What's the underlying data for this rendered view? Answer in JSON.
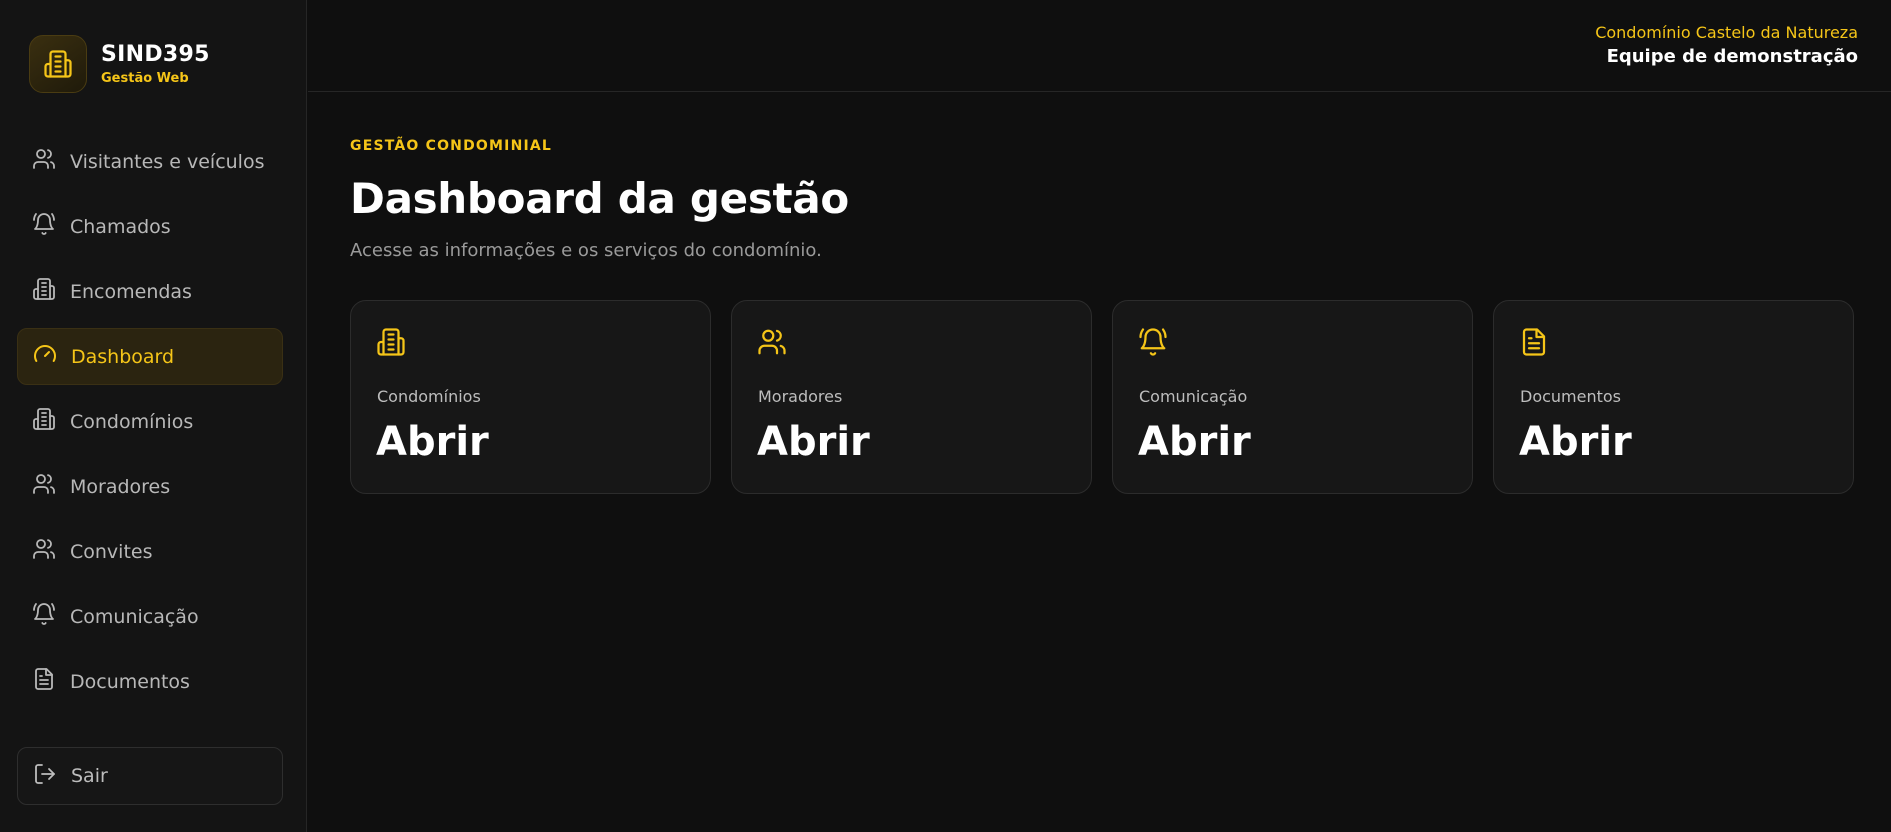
{
  "brand": {
    "name": "SIND395",
    "subtitle": "Gestão Web"
  },
  "sidebar": {
    "items": [
      {
        "label": "Visitantes e veículos",
        "icon": "users-icon"
      },
      {
        "label": "Chamados",
        "icon": "bell-ring-icon"
      },
      {
        "label": "Encomendas",
        "icon": "building-icon"
      },
      {
        "label": "Dashboard",
        "icon": "gauge-icon",
        "active": true
      },
      {
        "label": "Condomínios",
        "icon": "building-icon"
      },
      {
        "label": "Moradores",
        "icon": "users-icon"
      },
      {
        "label": "Convites",
        "icon": "users-icon"
      },
      {
        "label": "Comunicação",
        "icon": "bell-ring-icon"
      },
      {
        "label": "Documentos",
        "icon": "file-text-icon"
      }
    ],
    "logout_label": "Sair",
    "logout_icon": "logout-icon"
  },
  "header": {
    "condominium": "Condomínio Castelo da Natureza",
    "team": "Equipe de demonstração"
  },
  "main": {
    "eyebrow": "GESTÃO CONDOMINIAL",
    "title": "Dashboard da gestão",
    "description": "Acesse as informações e os serviços do condomínio.",
    "cards": [
      {
        "label": "Condomínios",
        "value": "Abrir",
        "icon": "building-icon"
      },
      {
        "label": "Moradores",
        "value": "Abrir",
        "icon": "users-icon"
      },
      {
        "label": "Comunicação",
        "value": "Abrir",
        "icon": "bell-ring-icon"
      },
      {
        "label": "Documentos",
        "value": "Abrir",
        "icon": "file-text-icon"
      }
    ]
  },
  "colors": {
    "accent": "#f5c518",
    "background": "#0f0f0f",
    "sidebar": "#141414"
  }
}
